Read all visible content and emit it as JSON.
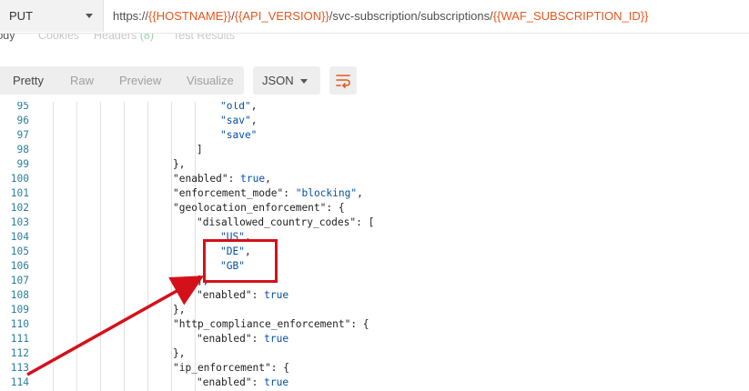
{
  "request": {
    "method": "PUT",
    "url_parts": [
      {
        "text": "https://",
        "var": false
      },
      {
        "text": "{{HOSTNAME}}",
        "var": true
      },
      {
        "text": "/",
        "var": false
      },
      {
        "text": "{{API_VERSION}}",
        "var": true
      },
      {
        "text": "/svc-subscription/subscriptions/",
        "var": false
      },
      {
        "text": "{{WAF_SUBSCRIPTION_ID}}",
        "var": true
      }
    ]
  },
  "tabs": {
    "body": "Body",
    "cookies": "Cookies",
    "headers": "Headers",
    "headers_count": "(8)",
    "tests": "Test Results"
  },
  "toolbar": {
    "views": [
      "Pretty",
      "Raw",
      "Preview",
      "Visualize"
    ],
    "format": "JSON",
    "wrap_icon": "wrap-lines-icon"
  },
  "code": {
    "first_line": 95,
    "lines": [
      [
        [
          "\"old\"",
          "str"
        ],
        [
          ",",
          ""
        ]
      ],
      [
        [
          "\"sav\"",
          "str"
        ],
        [
          ",",
          ""
        ]
      ],
      [
        [
          "\"save\"",
          "str"
        ]
      ],
      [
        [
          "]",
          ""
        ]
      ],
      [
        [
          "},",
          ""
        ]
      ],
      [
        [
          "\"enabled\"",
          "key"
        ],
        [
          ": ",
          ""
        ],
        [
          "true",
          "kw"
        ],
        [
          ",",
          ""
        ]
      ],
      [
        [
          "\"enforcement_mode\"",
          "key"
        ],
        [
          ": ",
          ""
        ],
        [
          "\"blocking\"",
          "str"
        ],
        [
          ",",
          ""
        ]
      ],
      [
        [
          "\"geolocation_enforcement\"",
          "key"
        ],
        [
          ": {",
          ""
        ]
      ],
      [
        [
          "\"disallowed_country_codes\"",
          "key"
        ],
        [
          ": [",
          ""
        ]
      ],
      [
        [
          "\"US\"",
          "str"
        ],
        [
          ",",
          ""
        ]
      ],
      [
        [
          "\"DE\"",
          "str"
        ],
        [
          ",",
          ""
        ]
      ],
      [
        [
          "\"GB\"",
          "str"
        ]
      ],
      [
        [
          "],",
          ""
        ]
      ],
      [
        [
          "\"enabled\"",
          "key"
        ],
        [
          ": ",
          ""
        ],
        [
          "true",
          "kw"
        ]
      ],
      [
        [
          "},",
          ""
        ]
      ],
      [
        [
          "\"http_compliance_enforcement\"",
          "key"
        ],
        [
          ": {",
          ""
        ]
      ],
      [
        [
          "\"enabled\"",
          "key"
        ],
        [
          ": ",
          ""
        ],
        [
          "true",
          "kw"
        ]
      ],
      [
        [
          "},",
          ""
        ]
      ],
      [
        [
          "\"ip_enforcement\"",
          "key"
        ],
        [
          ": {",
          ""
        ]
      ],
      [
        [
          "\"enabled\"",
          "key"
        ],
        [
          ": ",
          ""
        ],
        [
          "true",
          "kw"
        ]
      ]
    ]
  },
  "annotation": {
    "box_color": "#d4111b",
    "arrow_color": "#d4111b"
  }
}
